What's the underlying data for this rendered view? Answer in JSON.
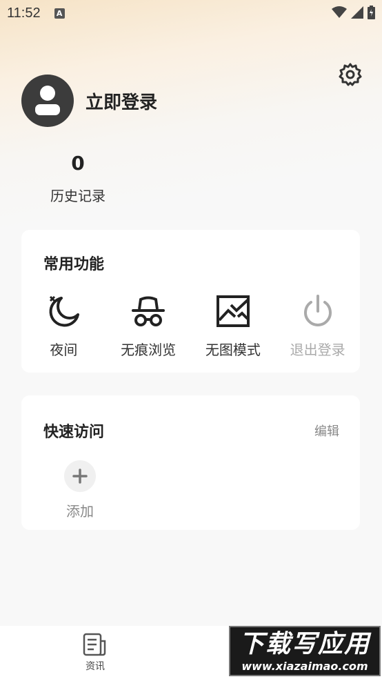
{
  "status_bar": {
    "time": "11:52",
    "notification_letter": "A"
  },
  "profile": {
    "login_text": "立即登录"
  },
  "history": {
    "count": "0",
    "label": "历史记录"
  },
  "common_functions": {
    "title": "常用功能",
    "items": [
      {
        "label": "夜间",
        "icon": "night-mode-icon",
        "enabled": true
      },
      {
        "label": "无痕浏览",
        "icon": "incognito-icon",
        "enabled": true
      },
      {
        "label": "无图模式",
        "icon": "no-image-icon",
        "enabled": true
      },
      {
        "label": "退出登录",
        "icon": "power-icon",
        "enabled": false
      }
    ]
  },
  "quick_access": {
    "title": "快速访问",
    "edit_label": "编辑",
    "add_label": "添加"
  },
  "bottom_nav": {
    "news_label": "资讯"
  },
  "watermark": {
    "main": "下载写应用",
    "sub": "www.xiazaimao.com"
  },
  "colors": {
    "accent_text": "#222222",
    "disabled": "#aaaaaa",
    "avatar": "#3c3c3c"
  }
}
